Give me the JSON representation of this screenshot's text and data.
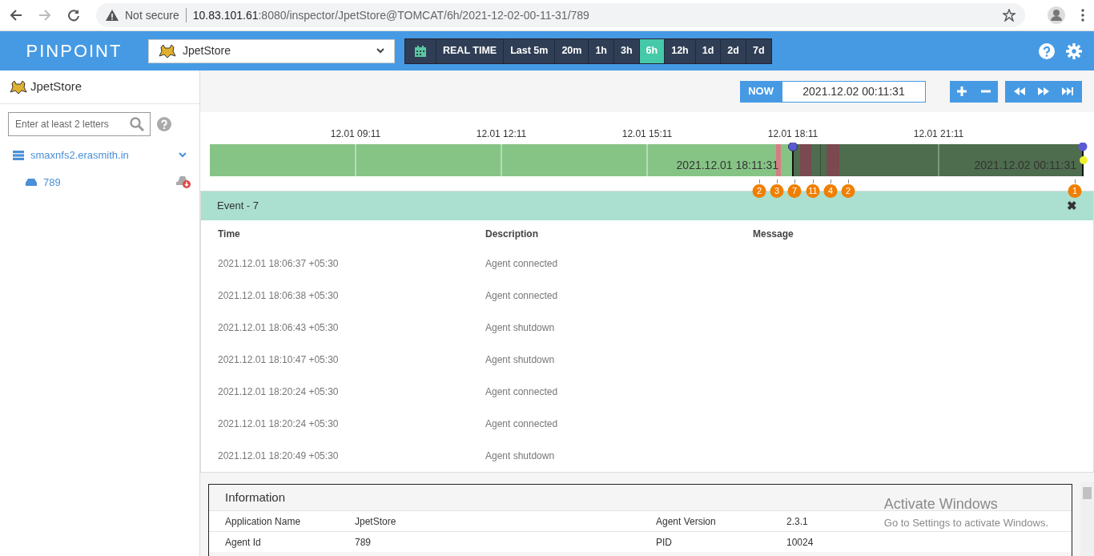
{
  "browser": {
    "security": "Not secure",
    "url_host": "10.83.101.61",
    "url_path": ":8080/inspector/JpetStore@TOMCAT/6h/2021-12-02-00-11-31/789"
  },
  "header": {
    "logo": "PINPOINT",
    "app_select": "JpetStore",
    "ranges": [
      {
        "label": "REAL TIME",
        "selected": false
      },
      {
        "label": "Last 5m",
        "selected": false
      },
      {
        "label": "20m",
        "selected": false
      },
      {
        "label": "1h",
        "selected": false
      },
      {
        "label": "3h",
        "selected": false
      },
      {
        "label": "6h",
        "selected": true
      },
      {
        "label": "12h",
        "selected": false
      },
      {
        "label": "1d",
        "selected": false
      },
      {
        "label": "2d",
        "selected": false
      },
      {
        "label": "7d",
        "selected": false
      }
    ]
  },
  "sidebar": {
    "app": "JpetStore",
    "search": {
      "placeholder": "Enter at least 2 letters"
    },
    "hosts": [
      {
        "name": "smaxnfs2.erasmith.in",
        "expanded": true,
        "children": [
          {
            "name": "789"
          }
        ]
      }
    ]
  },
  "toolbar": {
    "now_label": "NOW",
    "now_value": "2021.12.02 00:11:31"
  },
  "timeline": {
    "ticks": [
      "12.01 09:11",
      "12.01 12:11",
      "12.01 15:11",
      "12.01 18:11",
      "12.01 21:11"
    ],
    "from": "2021.12.01 18:11:31",
    "to": "2021.12.02 00:11:31",
    "event_counts": [
      "2",
      "3",
      "7",
      "11",
      "4",
      "2",
      "1"
    ]
  },
  "events": {
    "title": "Event - 7",
    "close": "✖",
    "columns": [
      "Time",
      "Description",
      "Message"
    ],
    "rows": [
      [
        "2021.12.01 18:06:37 +05:30",
        "Agent connected"
      ],
      [
        "2021.12.01 18:06:38 +05:30",
        "Agent connected"
      ],
      [
        "2021.12.01 18:06:43 +05:30",
        "Agent shutdown"
      ],
      [
        "2021.12.01 18:10:47 +05:30",
        "Agent shutdown"
      ],
      [
        "2021.12.01 18:20:24 +05:30",
        "Agent connected"
      ],
      [
        "2021.12.01 18:20:24 +05:30",
        "Agent connected"
      ],
      [
        "2021.12.01 18:20:49 +05:30",
        "Agent shutdown"
      ]
    ]
  },
  "information": {
    "title": "Information",
    "rows": [
      [
        "Application Name",
        "JpetStore",
        "Agent Version",
        "2.3.1"
      ],
      [
        "Agent Id",
        "789",
        "PID",
        "10024"
      ]
    ]
  },
  "os_notice": {
    "title": "Activate Windows",
    "text": "Go to Settings to activate Windows."
  }
}
